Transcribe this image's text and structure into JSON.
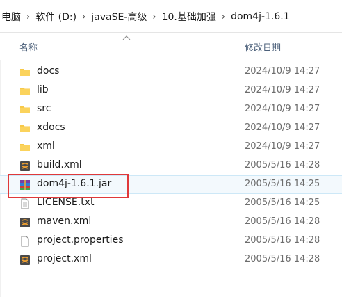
{
  "breadcrumb": [
    {
      "label": "电脑"
    },
    {
      "label": "软件 (D:)"
    },
    {
      "label": "javaSE-高级"
    },
    {
      "label": "10.基础加强"
    },
    {
      "label": "dom4j-1.6.1"
    }
  ],
  "columns": {
    "name": "名称",
    "date": "修改日期"
  },
  "files": [
    {
      "name": "docs",
      "date": "2024/10/9 14:27",
      "icon": "folder-icon"
    },
    {
      "name": "lib",
      "date": "2024/10/9 14:27",
      "icon": "folder-icon"
    },
    {
      "name": "src",
      "date": "2024/10/9 14:27",
      "icon": "folder-icon"
    },
    {
      "name": "xdocs",
      "date": "2024/10/9 14:27",
      "icon": "folder-icon"
    },
    {
      "name": "xml",
      "date": "2024/10/9 14:27",
      "icon": "folder-icon"
    },
    {
      "name": "build.xml",
      "date": "2005/5/16 14:28",
      "icon": "xml-file-icon"
    },
    {
      "name": "dom4j-1.6.1.jar",
      "date": "2005/5/16 14:25",
      "icon": "jar-archive-icon"
    },
    {
      "name": "LICENSE.txt",
      "date": "2005/5/16 14:25",
      "icon": "text-file-icon"
    },
    {
      "name": "maven.xml",
      "date": "2005/5/16 14:28",
      "icon": "xml-file-icon"
    },
    {
      "name": "project.properties",
      "date": "2005/5/16 14:28",
      "icon": "text-file-icon"
    },
    {
      "name": "project.xml",
      "date": "2005/5/16 14:28",
      "icon": "xml-file-icon"
    }
  ],
  "colors": {
    "folder": "#f8c948",
    "highlight": "#e0393a",
    "header_text": "#4c607a"
  }
}
